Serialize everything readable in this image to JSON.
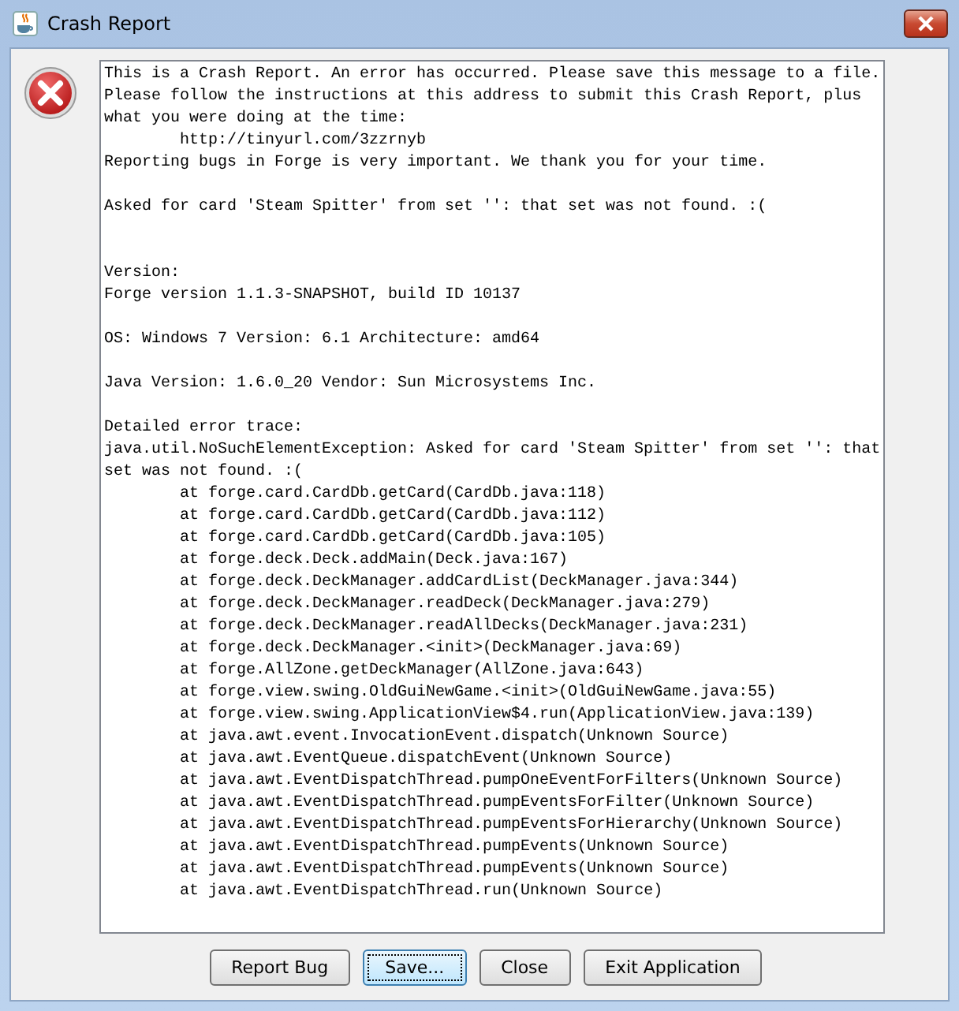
{
  "window": {
    "title": "Crash Report"
  },
  "report": {
    "text": "This is a Crash Report. An error has occurred. Please save this message to a file.\nPlease follow the instructions at this address to submit this Crash Report, plus\nwhat you were doing at the time:\n\thttp://tinyurl.com/3zzrnyb\nReporting bugs in Forge is very important. We thank you for your time.\n\nAsked for card 'Steam Spitter' from set '': that set was not found. :(\n\n\nVersion:\nForge version 1.1.3-SNAPSHOT, build ID 10137\n\nOS: Windows 7 Version: 6.1 Architecture: amd64\n\nJava Version: 1.6.0_20 Vendor: Sun Microsystems Inc.\n\nDetailed error trace:\njava.util.NoSuchElementException: Asked for card 'Steam Spitter' from set '': that\nset was not found. :(\n\tat forge.card.CardDb.getCard(CardDb.java:118)\n\tat forge.card.CardDb.getCard(CardDb.java:112)\n\tat forge.card.CardDb.getCard(CardDb.java:105)\n\tat forge.deck.Deck.addMain(Deck.java:167)\n\tat forge.deck.DeckManager.addCardList(DeckManager.java:344)\n\tat forge.deck.DeckManager.readDeck(DeckManager.java:279)\n\tat forge.deck.DeckManager.readAllDecks(DeckManager.java:231)\n\tat forge.deck.DeckManager.<init>(DeckManager.java:69)\n\tat forge.AllZone.getDeckManager(AllZone.java:643)\n\tat forge.view.swing.OldGuiNewGame.<init>(OldGuiNewGame.java:55)\n\tat forge.view.swing.ApplicationView$4.run(ApplicationView.java:139)\n\tat java.awt.event.InvocationEvent.dispatch(Unknown Source)\n\tat java.awt.EventQueue.dispatchEvent(Unknown Source)\n\tat java.awt.EventDispatchThread.pumpOneEventForFilters(Unknown Source)\n\tat java.awt.EventDispatchThread.pumpEventsForFilter(Unknown Source)\n\tat java.awt.EventDispatchThread.pumpEventsForHierarchy(Unknown Source)\n\tat java.awt.EventDispatchThread.pumpEvents(Unknown Source)\n\tat java.awt.EventDispatchThread.pumpEvents(Unknown Source)\n\tat java.awt.EventDispatchThread.run(Unknown Source)"
  },
  "buttons": [
    {
      "label": "Report Bug",
      "focused": false
    },
    {
      "label": "Save...",
      "focused": true
    },
    {
      "label": "Close",
      "focused": false
    },
    {
      "label": "Exit Application",
      "focused": false
    }
  ]
}
